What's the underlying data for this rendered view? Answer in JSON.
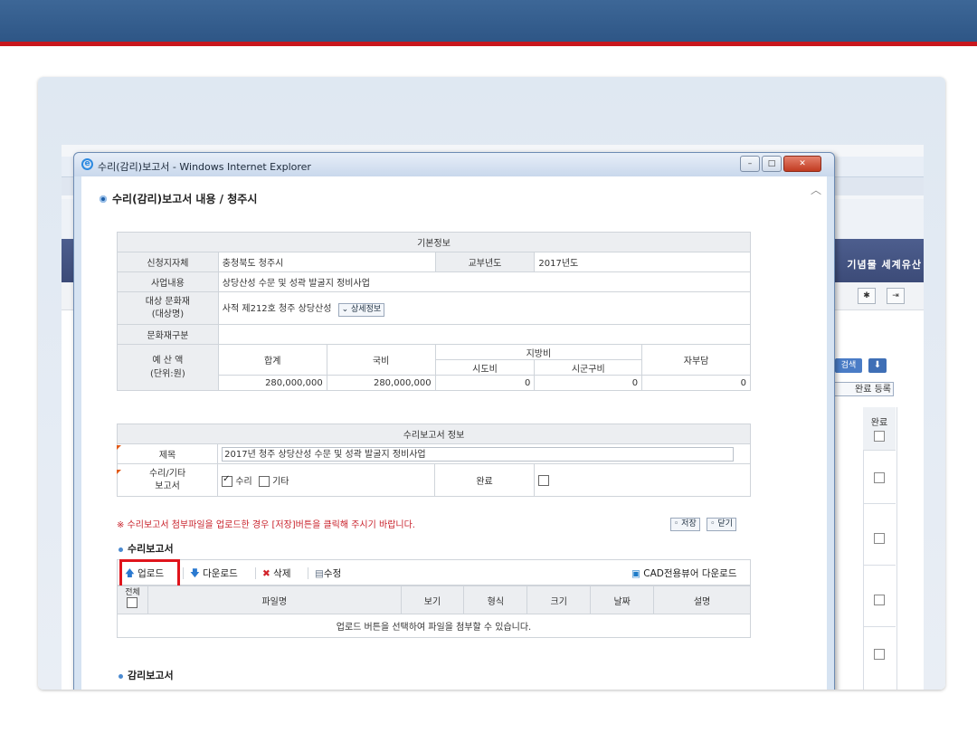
{
  "window": {
    "title": "수리(감리)보고서 - Windows Internet Explorer"
  },
  "background": {
    "nav_text": "기념물  세계유산",
    "search_label": "검색",
    "complete_register": "완료 등록",
    "col_complete": "완료"
  },
  "heading": "수리(감리)보고서 내용 / 청주시",
  "basic_info": {
    "caption": "기본정보",
    "applicant_label": "신청지자체",
    "applicant_value": "충청북도 청주시",
    "year_label": "교부년도",
    "year_value": "2017년도",
    "project_label": "사업내용",
    "project_value": "상당산성 수문 및 성곽 발굴지 정비사업",
    "heritage_label_1": "대상 문화재",
    "heritage_label_2": "(대상명)",
    "heritage_value": "사적 제212호 청주 상당산성",
    "detail_button": "상세정보",
    "heritage_type_label": "문화재구분",
    "heritage_type_value": "",
    "budget_label_1": "예 산 액",
    "budget_label_2": "(단위:원)",
    "total_label": "합계",
    "national_label": "국비",
    "local_label": "지방비",
    "province_label": "시도비",
    "city_label": "시군구비",
    "self_label": "자부담",
    "total_value": "280,000,000",
    "national_value": "280,000,000",
    "province_value": "0",
    "city_value": "0",
    "self_value": "0"
  },
  "report_info": {
    "caption": "수리보고서 정보",
    "title_label": "제목",
    "title_value": "2017년 청주 상당산성 수문 및 성곽 발굴지 정비사업",
    "type_label_1": "수리/기타",
    "type_label_2": "보고서",
    "repair_option": "수리",
    "other_option": "기타",
    "complete_label": "완료"
  },
  "notice": "※ 수리보고서 첨부파일을 업로드한 경우 [저장]버튼을 클릭해 주시기 바랍니다.",
  "actions": {
    "save": "저장",
    "close": "닫기"
  },
  "repair_section": {
    "title": "수리보고서",
    "upload": "업로드",
    "download": "다운로드",
    "delete": "삭제",
    "edit": "수정",
    "cad_viewer": "CAD전용뷰어 다운로드",
    "columns": [
      "전체",
      "파일명",
      "보기",
      "형식",
      "크기",
      "날짜",
      "설명"
    ],
    "empty_message": "업로드 버튼을 선택하여 파일을 첨부할 수 있습니다."
  },
  "supervision_section": {
    "title": "감리보고서"
  },
  "colors": {
    "topbar": "#2e5686",
    "accent_red": "#c8161d",
    "highlight_box": "#e0141c"
  }
}
